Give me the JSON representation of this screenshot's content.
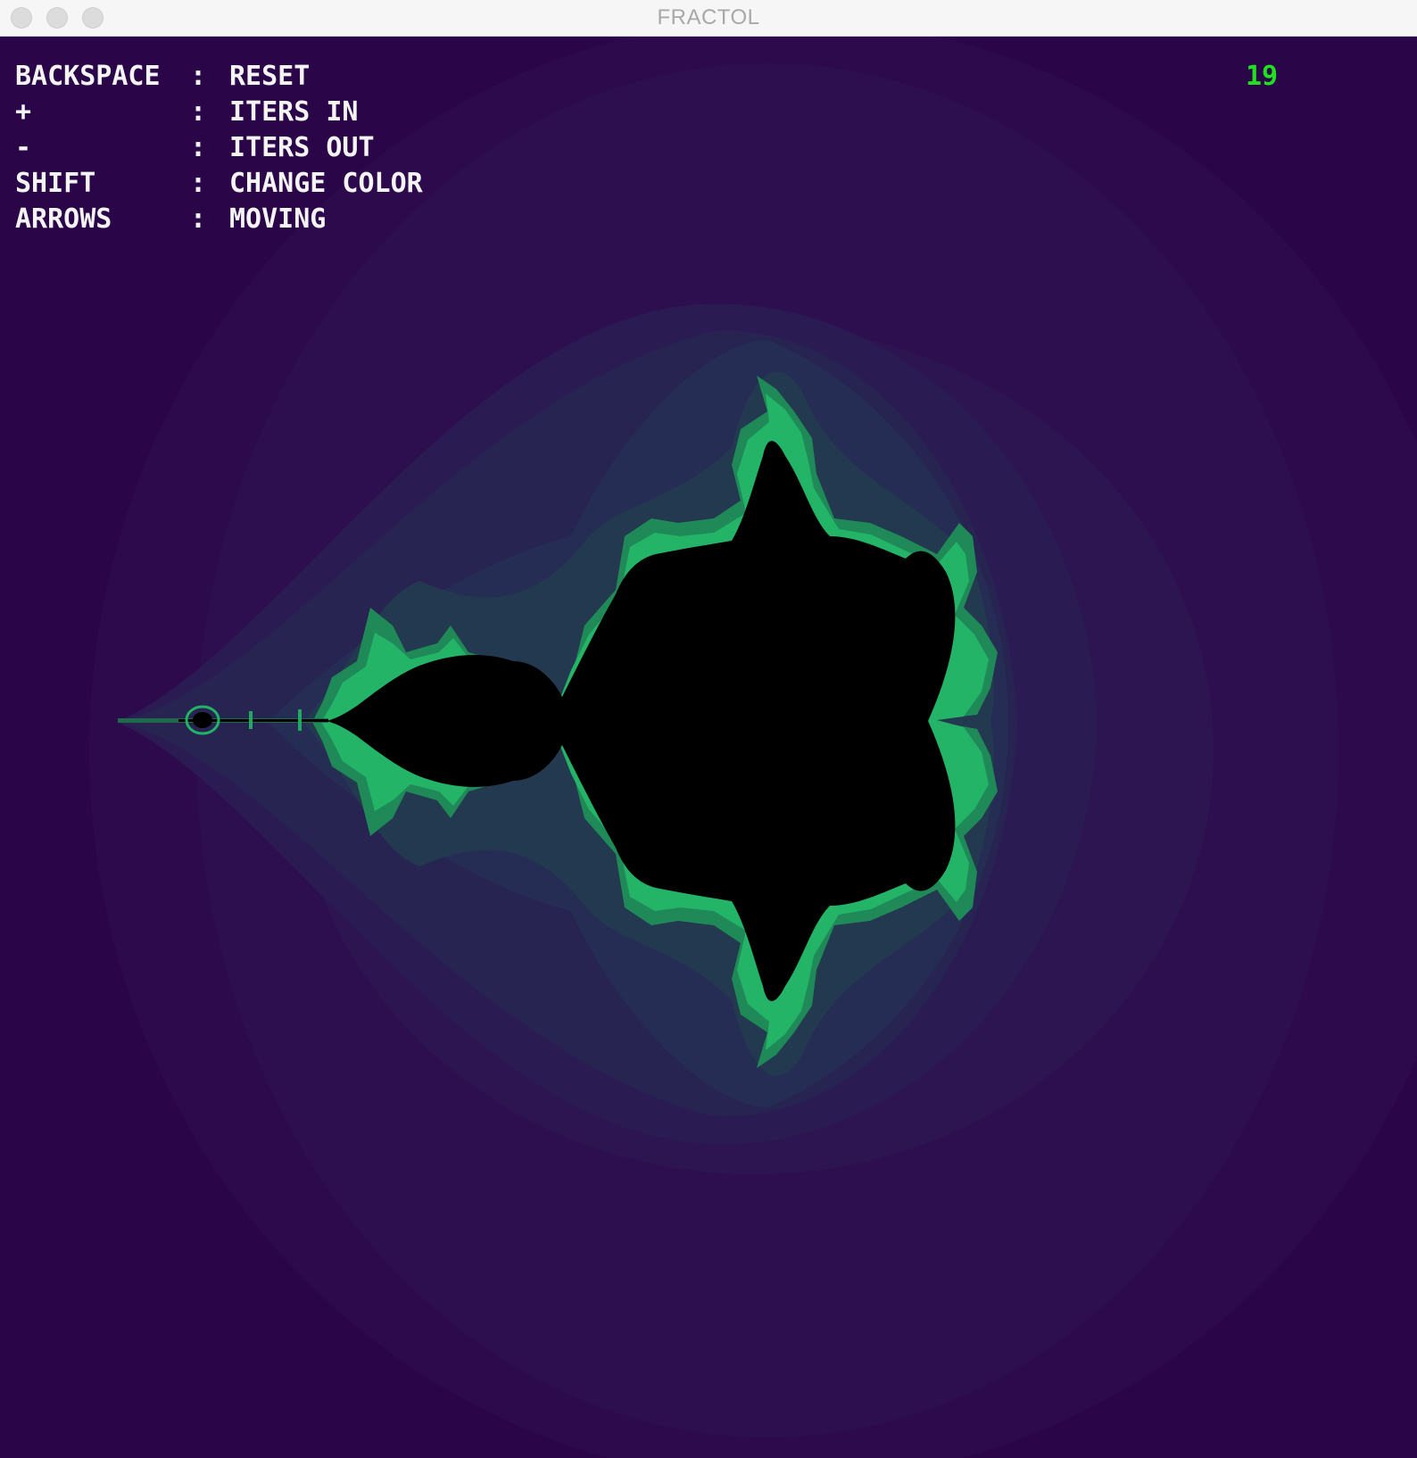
{
  "window": {
    "title": "FRACTOL"
  },
  "help": {
    "rows": [
      {
        "key": "BACKSPACE",
        "sep": ":",
        "action": "RESET"
      },
      {
        "key": "+",
        "sep": ":",
        "action": "ITERS IN"
      },
      {
        "key": "-",
        "sep": ":",
        "action": "ITERS OUT"
      },
      {
        "key": "SHIFT",
        "sep": ":",
        "action": "CHANGE COLOR"
      },
      {
        "key": "ARROWS",
        "sep": ":",
        "action": "MOVING"
      }
    ]
  },
  "iterations": {
    "value": "19",
    "color": "#20e020"
  },
  "colors": {
    "background": "#2a0548",
    "set_interior": "#000000",
    "edge_accent": "#22c46a"
  }
}
